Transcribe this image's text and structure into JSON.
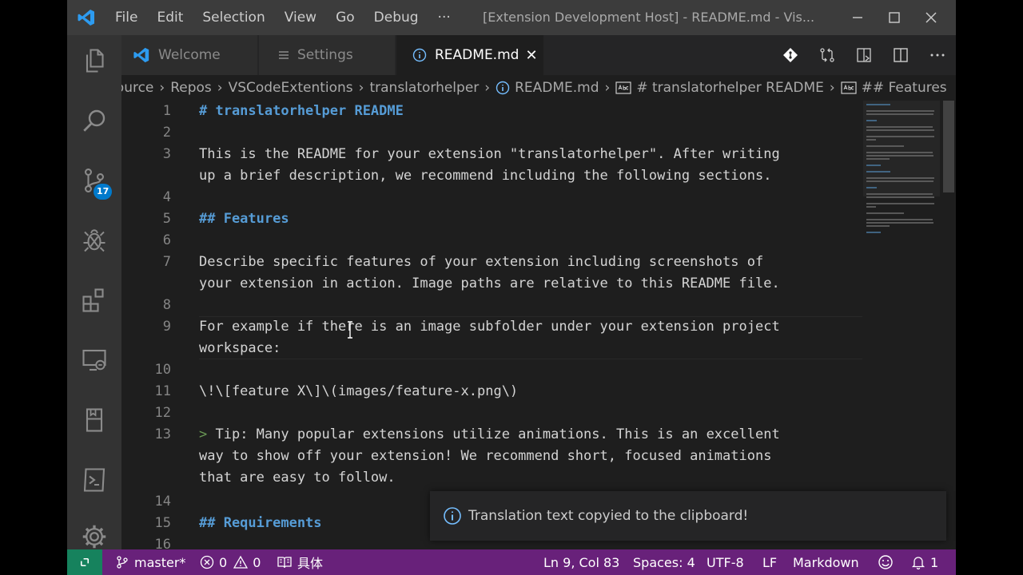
{
  "titlebar": {
    "menu": [
      "File",
      "Edit",
      "Selection",
      "View",
      "Go",
      "Debug",
      "···"
    ],
    "title": "[Extension Development Host] - README.md - Vis..."
  },
  "activity_icons": [
    "files-icon",
    "search-icon",
    "source-control-icon",
    "debug-icon",
    "extensions-icon",
    "remote-explorer-icon",
    "bookmark-icon",
    "terminal-icon",
    "gear-icon"
  ],
  "activity_badge": "17",
  "tabs": [
    {
      "label": "Welcome",
      "icon": "vscode-logo-icon",
      "active": false
    },
    {
      "label": "Settings",
      "icon": "settings-list-icon",
      "active": false
    },
    {
      "label": "README.md",
      "icon": "info-icon",
      "active": true,
      "close": "✕"
    }
  ],
  "breadcrumb": [
    "Source",
    "Repos",
    "VSCodeExtentions",
    "translatorhelper",
    "README.md",
    "# translatorhelper README",
    "## Features"
  ],
  "editor": {
    "line_numbers": [
      "1",
      "2",
      "3",
      "",
      "4",
      "5",
      "6",
      "7",
      "",
      "8",
      "9",
      "",
      "10",
      "11",
      "12",
      "13",
      "",
      "",
      "14",
      "15",
      "16"
    ],
    "lines": [
      {
        "text": "# translatorhelper README",
        "kind": "heading"
      },
      {
        "text": "",
        "kind": "text"
      },
      {
        "text": "This is the README for your extension \"translatorhelper\". After writing",
        "kind": "text"
      },
      {
        "text": "up a brief description, we recommend including the following sections.",
        "kind": "text"
      },
      {
        "text": "",
        "kind": "text"
      },
      {
        "text": "## Features",
        "kind": "heading"
      },
      {
        "text": "",
        "kind": "text"
      },
      {
        "text": "Describe specific features of your extension including screenshots of",
        "kind": "text"
      },
      {
        "text": "your extension in action. Image paths are relative to this README file.",
        "kind": "text"
      },
      {
        "text": "",
        "kind": "text"
      },
      {
        "text": "For example if there is an image subfolder under your extension project",
        "kind": "text"
      },
      {
        "text": "workspace:",
        "kind": "text"
      },
      {
        "text": "",
        "kind": "text"
      },
      {
        "text": "\\!\\[feature X\\]\\(images/feature-x.png\\)",
        "kind": "text"
      },
      {
        "text": "",
        "kind": "text"
      },
      {
        "text": "Tip: Many popular extensions utilize animations. This is an excellent",
        "kind": "quote",
        "marker": "> "
      },
      {
        "text": "way to show off your extension! We recommend short, focused animations",
        "kind": "text"
      },
      {
        "text": "that are easy to follow.",
        "kind": "text"
      },
      {
        "text": "",
        "kind": "text"
      },
      {
        "text": "## Requirements",
        "kind": "heading"
      },
      {
        "text": "",
        "kind": "text"
      }
    ]
  },
  "notification": {
    "icon": "info-icon",
    "message": "Translation text copyied to the clipboard!"
  },
  "statusbar": {
    "branch": "master*",
    "errors": "0",
    "warnings": "0",
    "language_pair": "具体",
    "position": "Ln 9, Col 83",
    "spaces": "Spaces: 4",
    "encoding": "UTF-8",
    "eol": "LF",
    "language": "Markdown",
    "notifications": "1"
  },
  "colors": {
    "statusbar": "#68217a",
    "remote": "#16825d",
    "accent": "#007acc",
    "heading": "#569cd6"
  }
}
